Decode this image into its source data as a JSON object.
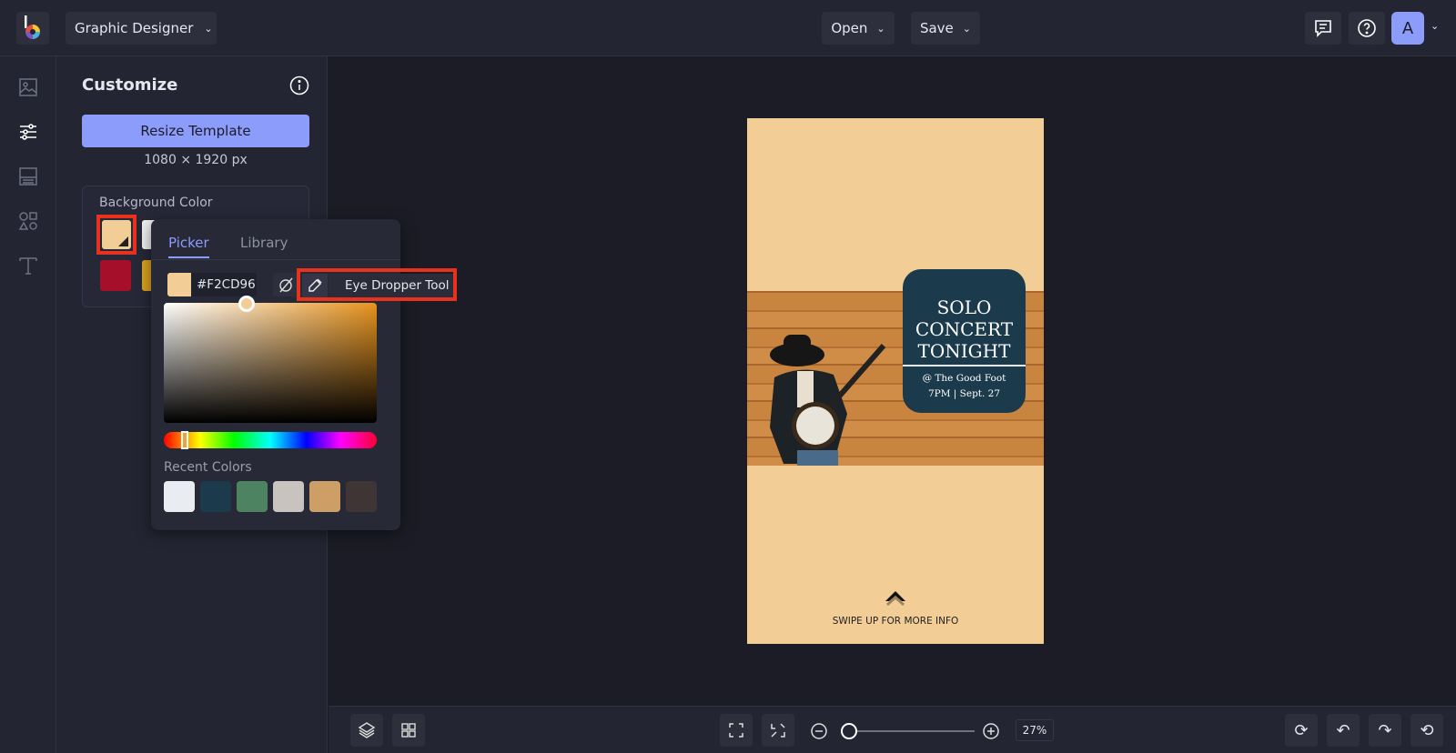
{
  "header": {
    "workspace": "Graphic Designer",
    "open": "Open",
    "save": "Save",
    "avatar": "A"
  },
  "sidebar": {
    "icons": [
      "image-icon",
      "sliders-icon",
      "layout-icon",
      "shapes-icon",
      "text-icon"
    ]
  },
  "panel": {
    "title": "Customize",
    "resize_button": "Resize Template",
    "dimensions": "1080 × 1920 px",
    "bg_label": "Background Color"
  },
  "picker": {
    "tabs": [
      "Picker",
      "Library"
    ],
    "active_tab": "Picker",
    "hex": "#F2CD96",
    "tooltip": "Eye Dropper Tool",
    "recent_label": "Recent Colors",
    "recent_colors": [
      "#e9edf1",
      "#1b3a4b",
      "#4e8361",
      "#c9c3c0",
      "#cd9f66",
      "#3e3534"
    ]
  },
  "swatches": [
    "#F2CD96",
    "#f1f1f1",
    "#a50f2a",
    "#d9a320"
  ],
  "poster": {
    "line1": "SOLO",
    "line2": "CONCERT",
    "line3": "TONIGHT",
    "venue": "@ The Good Foot",
    "time": "7PM | Sept. 27",
    "cta": "SWIPE UP FOR MORE INFO",
    "bg": "#F2CD96"
  },
  "zoom": {
    "level": "27%",
    "value": 27
  }
}
